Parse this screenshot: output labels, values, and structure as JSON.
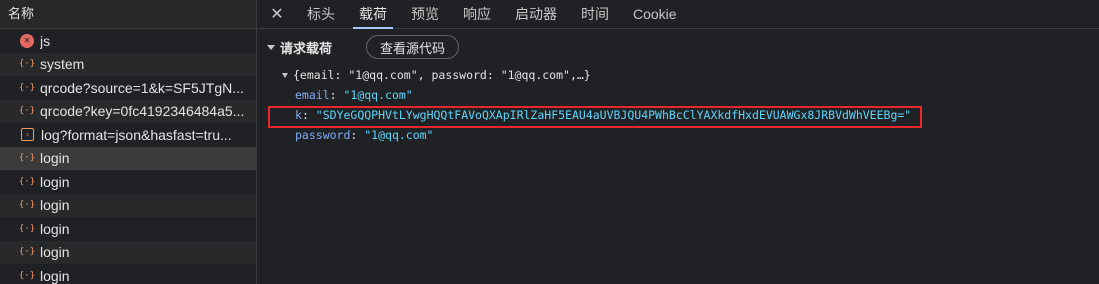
{
  "list": {
    "header": "名称",
    "items": [
      {
        "label": "js",
        "icon": "error-icon"
      },
      {
        "label": "system",
        "icon": "xhr-icon"
      },
      {
        "label": "qrcode?source=1&k=SF5JTgN...",
        "icon": "xhr-icon"
      },
      {
        "label": "qrcode?key=0fc4192346484a5...",
        "icon": "xhr-icon"
      },
      {
        "label": "log?format=json&hasfast=tru...",
        "icon": "doc-icon"
      },
      {
        "label": "login",
        "icon": "xhr-icon",
        "selected": true
      },
      {
        "label": "login",
        "icon": "xhr-icon"
      },
      {
        "label": "login",
        "icon": "xhr-icon"
      },
      {
        "label": "login",
        "icon": "xhr-icon"
      },
      {
        "label": "login",
        "icon": "xhr-icon"
      },
      {
        "label": "login",
        "icon": "xhr-icon"
      }
    ]
  },
  "tabs": {
    "close": "✕",
    "items": [
      "标头",
      "载荷",
      "预览",
      "响应",
      "启动器",
      "时间",
      "Cookie"
    ],
    "active": 1
  },
  "payload": {
    "section_title": "请求载荷",
    "view_source_label": "查看源代码",
    "summary": "{email: \"1@qq.com\", password: \"1@qq.com\",…}",
    "fields": [
      {
        "key": "email",
        "value": "\"1@qq.com\""
      },
      {
        "key": "k",
        "value": "\"SDYeGQQPHVtLYwgHQQtFAVoQXApIRlZaHF5EAU4aUVBJQU4PWhBcClYAXkdfHxdEVUAWGx8JRBVdWhVEEBg=\"",
        "highlighted": true
      },
      {
        "key": "password",
        "value": "\"1@qq.com\""
      }
    ]
  },
  "colors": {
    "background": "#202124",
    "highlight_border": "#e8262b",
    "key": "#7cacf8",
    "string": "#5cd5fb",
    "active_tab_underline": "#a8c7fa"
  }
}
